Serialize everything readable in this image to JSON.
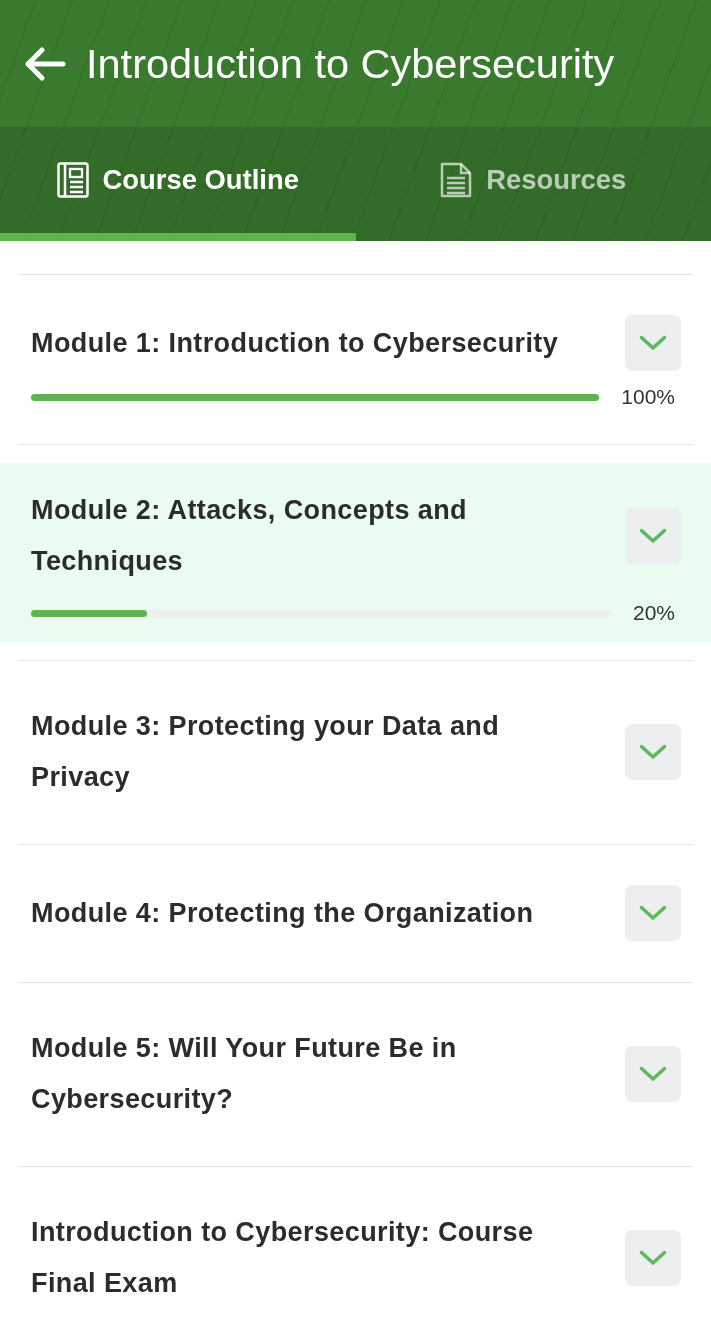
{
  "header": {
    "title": "Introduction to Cybersecurity"
  },
  "tabs": [
    {
      "label": "Course Outline",
      "selected": true
    },
    {
      "label": "Resources",
      "selected": false
    }
  ],
  "modules": [
    {
      "title": "Module 1: Introduction to Cybersecurity",
      "selected": false,
      "progress": {
        "level": 1,
        "reading": "100%"
      }
    },
    {
      "title": "Module 2: Attacks, Concepts and Techniques",
      "selected": true,
      "progress": {
        "level": 0.2,
        "reading": "20%"
      }
    },
    {
      "title": "Module 3: Protecting your Data and Privacy",
      "selected": false
    },
    {
      "title": "Module 4: Protecting the Organization",
      "selected": false
    },
    {
      "title": "Module 5: Will Your Future Be in Cybersecurity?",
      "selected": false
    },
    {
      "title": "Introduction to Cybersecurity: Course Final Exam",
      "selected": false
    }
  ]
}
